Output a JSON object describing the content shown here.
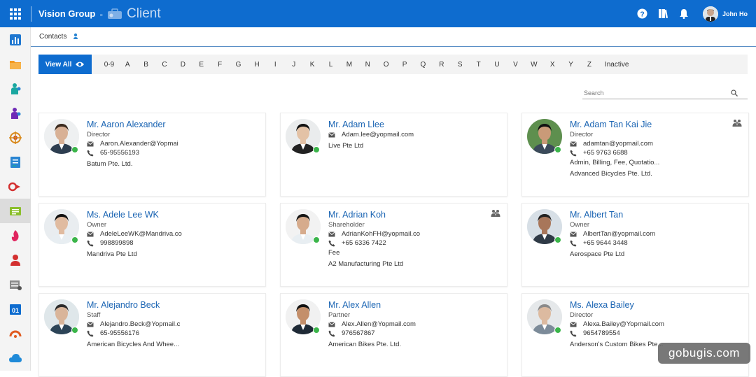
{
  "header": {
    "org": "Vision Group",
    "separator": "-",
    "app": "Client",
    "user_name": "John Ho",
    "accent": "#0e6ccf"
  },
  "breadcrumb": {
    "label": "Contacts"
  },
  "filter": {
    "view_all": "View All",
    "letters": [
      "0-9",
      "A",
      "B",
      "C",
      "D",
      "E",
      "F",
      "G",
      "H",
      "I",
      "J",
      "K",
      "L",
      "M",
      "N",
      "O",
      "P",
      "Q",
      "R",
      "S",
      "T",
      "U",
      "V",
      "W",
      "X",
      "Y",
      "Z",
      "Inactive"
    ]
  },
  "search": {
    "placeholder": "Search"
  },
  "contacts": [
    {
      "name": "Mr. Aaron Alexander",
      "role": "Director",
      "email": "Aaron.Alexander@Yopmai",
      "phone": "65-95556193",
      "extra": "",
      "company": "Batum Pte. Ltd.",
      "group": false
    },
    {
      "name": "Mr. Adam Llee",
      "role": "",
      "email": "Adam.lee@yopmail.com",
      "phone": "",
      "extra": "",
      "company": "Live Pte Ltd",
      "group": false
    },
    {
      "name": "Mr. Adam Tan Kai Jie",
      "role": "Director",
      "email": "adamtan@yopmail.com",
      "phone": "+65 9763 6688",
      "extra": "Admin, Billing, Fee, Quotatio...",
      "company": "Advanced Bicycles Pte. Ltd.",
      "group": true
    },
    {
      "name": "Ms. Adele Lee WK",
      "role": "Owner",
      "email": "AdeleLeeWK@Mandriva.co",
      "phone": "998899898",
      "extra": "",
      "company": "Mandriva Pte Ltd",
      "group": false
    },
    {
      "name": "Mr. Adrian Koh",
      "role": "Shareholder",
      "email": "AdrianKohFH@yopmail.co",
      "phone": "+65 6336 7422",
      "extra": "Fee",
      "company": "A2 Manufacturing Pte Ltd",
      "group": true
    },
    {
      "name": "Mr. Albert Tan",
      "role": "Owner",
      "email": "AlbertTan@yopmail.com",
      "phone": "+65 9644 3448",
      "extra": "",
      "company": "Aerospace Pte Ltd",
      "group": false
    },
    {
      "name": "Mr. Alejandro Beck",
      "role": "Staff",
      "email": "Alejandro.Beck@Yopmail.c",
      "phone": "65-95556176",
      "extra": "",
      "company": "American Bicycles And Whee...",
      "group": false
    },
    {
      "name": "Mr. Alex Allen",
      "role": "Partner",
      "email": "Alex.Allen@Yopmail.com",
      "phone": "976567867",
      "extra": "",
      "company": "American Bikes Pte. Ltd.",
      "group": false
    },
    {
      "name": "Ms. Alexa Bailey",
      "role": "Director",
      "email": "Alexa.Bailey@Yopmail.com",
      "phone": "9654789554",
      "extra": "",
      "company": "Anderson's Custom Bikes Pte...",
      "group": false
    }
  ],
  "watermark": "gobugis.com"
}
